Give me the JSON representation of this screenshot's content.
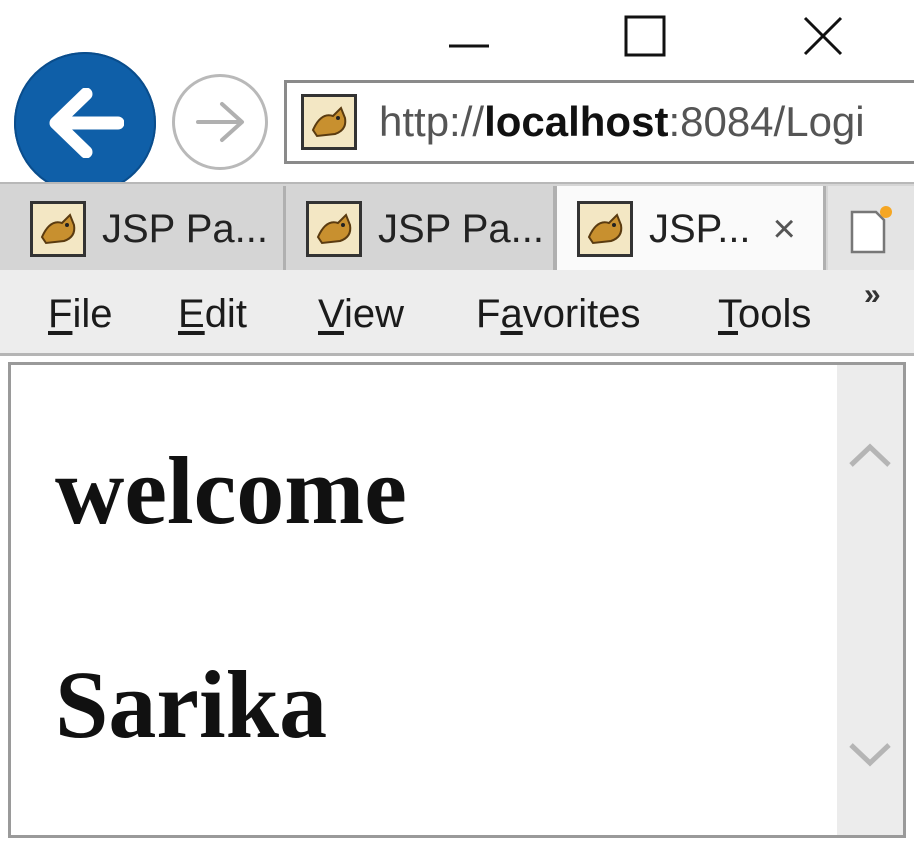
{
  "window_controls": {
    "minimize": "minimize-icon",
    "maximize": "maximize-icon",
    "close": "close-icon"
  },
  "nav": {
    "back_icon": "back-arrow-icon",
    "forward_icon": "forward-arrow-icon",
    "url_prefix": "http://",
    "url_host": "localhost",
    "url_rest": ":8084/Logi"
  },
  "tabs": [
    {
      "label": "JSP Pa...",
      "icon": "tomcat-favicon-icon",
      "active": false
    },
    {
      "label": "JSP Pa...",
      "icon": "tomcat-favicon-icon",
      "active": false
    },
    {
      "label": "JSP...",
      "icon": "tomcat-favicon-icon",
      "active": true,
      "close": "×"
    }
  ],
  "menubar": {
    "items": [
      {
        "label": "File",
        "accel": "F",
        "rest": "ile"
      },
      {
        "label": "Edit",
        "accel": "E",
        "rest": "dit"
      },
      {
        "label": "View",
        "accel": "V",
        "rest": "iew"
      },
      {
        "label": "Favorites",
        "pre": "F",
        "accel": "a",
        "rest": "vorites"
      },
      {
        "label": "Tools",
        "accel": "T",
        "rest": "ools"
      }
    ],
    "overflow": "»"
  },
  "page": {
    "line1": "welcome",
    "line2": "Sarika"
  },
  "colors": {
    "back_button": "#0f5fa8",
    "tabs_background": "#d5d5d5",
    "menubar_background": "#ededed"
  }
}
